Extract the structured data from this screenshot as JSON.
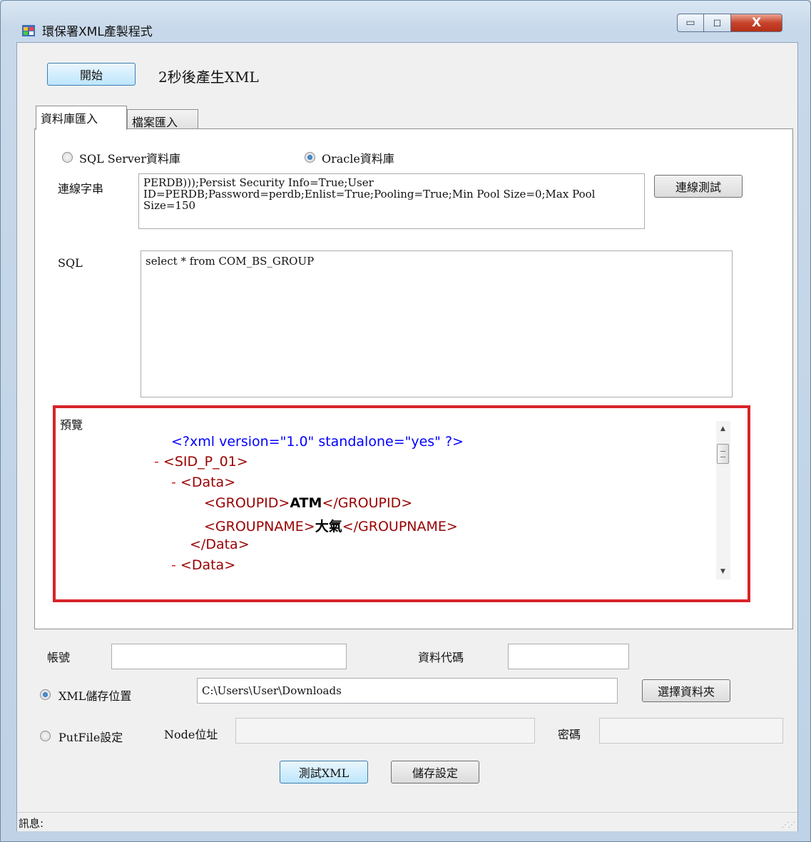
{
  "window": {
    "title": "環保署XML產製程式",
    "minimize_glyph": "▭",
    "maximize_glyph": "◻",
    "close_glyph": "X"
  },
  "top": {
    "start_button": "開始",
    "countdown_text": "2秒後產生XML"
  },
  "tabs": [
    {
      "label": "資料庫匯入",
      "active": true
    },
    {
      "label": "檔案匯入",
      "active": false
    }
  ],
  "db": {
    "sql_server_label": "SQL Server資料庫",
    "oracle_label": "Oracle資料庫",
    "selected": "oracle",
    "conn_label": "連線字串",
    "conn_value": "PERDB)));Persist Security Info=True;User ID=PERDB;Password=perdb;Enlist=True;Pooling=True;Min Pool Size=0;Max Pool Size=150",
    "test_conn_button": "連線測試",
    "sql_label": "SQL",
    "sql_value": "select * from COM_BS_GROUP"
  },
  "preview": {
    "label": "預覽",
    "lines": {
      "decl": "<?xml version=\"1.0\" standalone=\"yes\" ?>",
      "minus": "-",
      "root_open": "<SID_P_01>",
      "data_open": "<Data>",
      "gid_open": "<GROUPID>",
      "gid_value": "ATM",
      "gid_close": "</GROUPID>",
      "gname_open": "<GROUPNAME>",
      "gname_value": "大氣",
      "gname_close": "</GROUPNAME>",
      "data_close": "</Data>",
      "data_open2": "<Data>"
    }
  },
  "account": {
    "account_label": "帳號",
    "account_value": "",
    "datacode_label": "資料代碼",
    "datacode_value": ""
  },
  "xml_save": {
    "label": "XML儲存位置",
    "selected": true,
    "path": "C:\\Users\\User\\Downloads",
    "choose_button": "選擇資料夾"
  },
  "putfile": {
    "label": "PutFile設定",
    "selected": false,
    "node_label": "Node位址",
    "node_value": "",
    "password_label": "密碼",
    "password_value": ""
  },
  "actions": {
    "test_xml_button": "測試XML",
    "save_settings_button": "儲存設定"
  },
  "status": {
    "label": "訊息:"
  },
  "colors": {
    "highlight_border": "#d8232a",
    "xml_blue": "#0000ff",
    "xml_tag": "#990000"
  }
}
